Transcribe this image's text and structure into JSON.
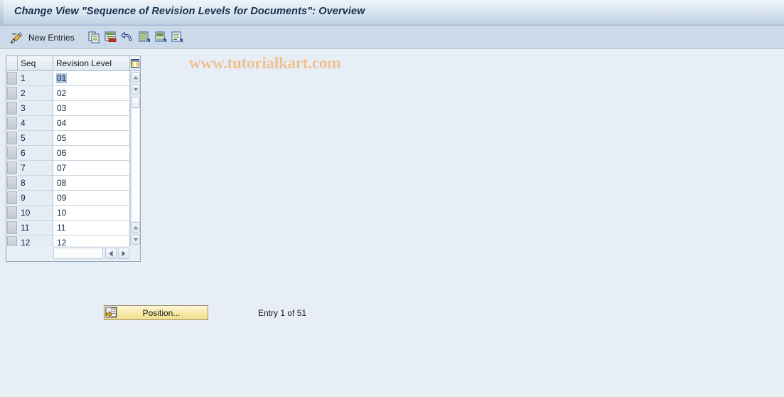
{
  "window": {
    "title": "Change View \"Sequence of Revision Levels for Documents\": Overview"
  },
  "toolbar": {
    "new_entries_label": "New Entries",
    "icons": {
      "new_entries": "pencil-icon",
      "copy": "copy-icon",
      "delete": "delete-row-icon",
      "undo": "undo-icon",
      "select_all": "select-all-icon",
      "deselect_all": "deselect-all-icon",
      "details": "details-icon",
      "table_settings": "table-settings-icon"
    }
  },
  "watermark": {
    "text": "www.tutorialkart.com",
    "color": "#eec194"
  },
  "table": {
    "columns": [
      "Seq",
      "Revision Level"
    ],
    "selected_cell": {
      "row": 0,
      "column": "Revision Level",
      "value": "01"
    },
    "rows": [
      {
        "seq": "1",
        "revision_level": "01"
      },
      {
        "seq": "2",
        "revision_level": "02"
      },
      {
        "seq": "3",
        "revision_level": "03"
      },
      {
        "seq": "4",
        "revision_level": "04"
      },
      {
        "seq": "5",
        "revision_level": "05"
      },
      {
        "seq": "6",
        "revision_level": "06"
      },
      {
        "seq": "7",
        "revision_level": "07"
      },
      {
        "seq": "8",
        "revision_level": "08"
      },
      {
        "seq": "9",
        "revision_level": "09"
      },
      {
        "seq": "10",
        "revision_level": "10"
      },
      {
        "seq": "11",
        "revision_level": "11"
      },
      {
        "seq": "12",
        "revision_level": "12"
      }
    ]
  },
  "footer": {
    "position_button_label": "Position...",
    "entry_status": "Entry 1 of 51"
  },
  "colors": {
    "title_bar": "#c2d4e6",
    "toolbar": "#ccd9e8",
    "background": "#e8eef5",
    "button_yellow": "#f7e9a8",
    "selection": "#a9c2dc"
  }
}
